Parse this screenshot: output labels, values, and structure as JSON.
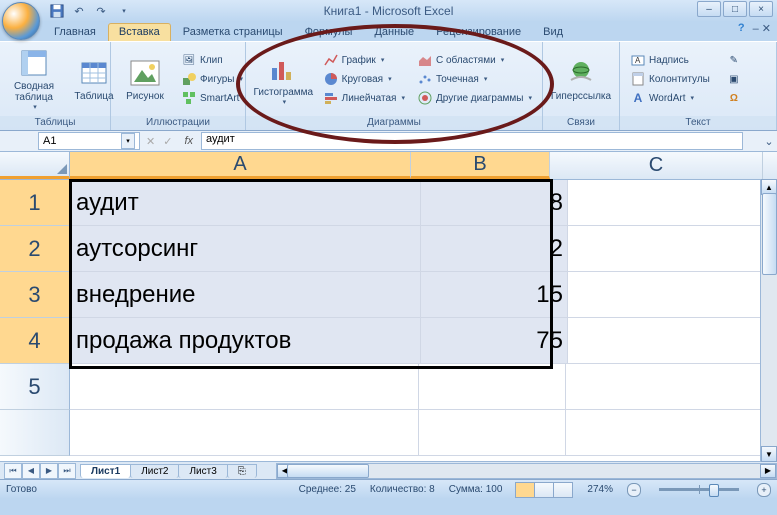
{
  "title": "Книга1 - Microsoft Excel",
  "tabs": {
    "t0": "Главная",
    "t1": "Вставка",
    "t2": "Разметка страницы",
    "t3": "Формулы",
    "t4": "Данные",
    "t5": "Рецензирование",
    "t6": "Вид"
  },
  "ribbon": {
    "tables_group": "Таблицы",
    "pivot_table": "Сводная\nтаблица",
    "table": "Таблица",
    "illustrations_group": "Иллюстрации",
    "picture": "Рисунок",
    "clip": "Клип",
    "shapes": "Фигуры",
    "smartart": "SmartArt",
    "charts_group": "Диаграммы",
    "column_chart": "Гистограмма",
    "line_chart": "График",
    "pie_chart": "Круговая",
    "bar_chart": "Линейчатая",
    "area_chart": "С областями",
    "scatter_chart": "Точечная",
    "other_charts": "Другие диаграммы",
    "links_group": "Связи",
    "hyperlink": "Гиперссылка",
    "text_group": "Текст",
    "text_box": "Надпись",
    "header_footer": "Колонтитулы",
    "wordart": "WordArt"
  },
  "namebox": "A1",
  "formula": "аудит",
  "columns": {
    "A": "A",
    "B": "B",
    "C": "C"
  },
  "cells": {
    "r1": {
      "num": "1",
      "a": "аудит",
      "b": "8"
    },
    "r2": {
      "num": "2",
      "a": "аутсорсинг",
      "b": "2"
    },
    "r3": {
      "num": "3",
      "a": "внедрение",
      "b": "15"
    },
    "r4": {
      "num": "4",
      "a": "продажа продуктов",
      "b": "75"
    },
    "r5": {
      "num": "5",
      "a": "",
      "b": ""
    }
  },
  "sheets": {
    "s1": "Лист1",
    "s2": "Лист2",
    "s3": "Лист3"
  },
  "status": {
    "ready": "Готово",
    "avg": "Среднее: 25",
    "count": "Количество: 8",
    "sum": "Сумма: 100",
    "zoom": "274%"
  }
}
